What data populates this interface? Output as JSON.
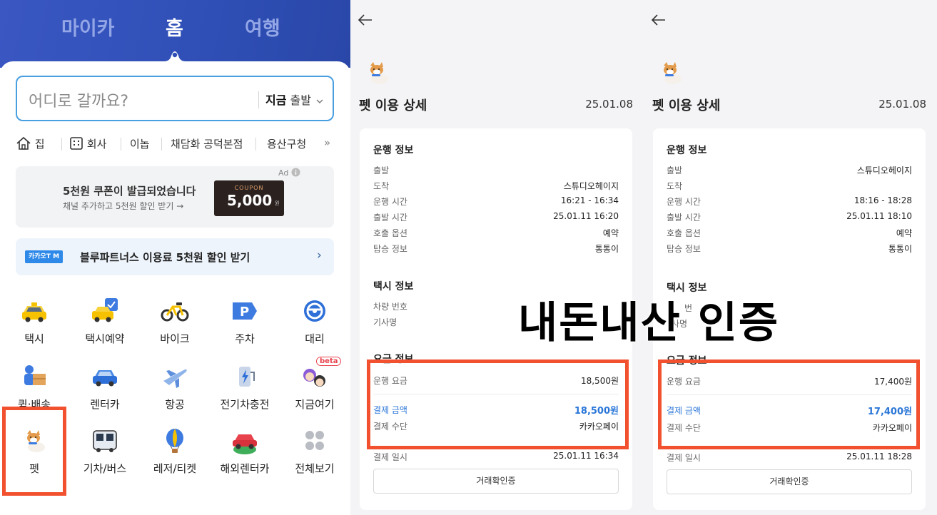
{
  "home": {
    "tabs": [
      "마이카",
      "홈",
      "여행"
    ],
    "active_tab": "홈",
    "search": {
      "placeholder": "어디로 갈까요?",
      "time_bold": "지금",
      "time_rest": "출발",
      "chevron": "chevron-down-icon"
    },
    "places": [
      {
        "label": "집",
        "icon": "home-icon"
      },
      {
        "label": "회사",
        "icon": "building-icon"
      },
      {
        "label": "이놉"
      },
      {
        "label": "채담화 공덕본점"
      },
      {
        "label": "용산구청"
      }
    ],
    "places_more": "»",
    "coupon_banner": {
      "title": "5천원 쿠폰이 발급되었습니다",
      "subtitle": "채널 추가하고 5천원 할인 받기 →",
      "ticket_label": "COUPON",
      "ticket_amount": "5,000",
      "ticket_unit": "원",
      "ad_mark": "Ad"
    },
    "bluepartners_banner": {
      "badge": "카카오T M",
      "text": "블루파트너스 이용료 5천원 할인 받기",
      "chevron": "›"
    },
    "services": [
      {
        "label": "택시",
        "icon": "taxi-icon"
      },
      {
        "label": "택시예약",
        "icon": "taxi-reserve-icon"
      },
      {
        "label": "바이크",
        "icon": "bike-icon"
      },
      {
        "label": "주차",
        "icon": "parking-icon"
      },
      {
        "label": "대리",
        "icon": "steering-wheel-icon"
      },
      {
        "label": "퀵·배송",
        "icon": "delivery-icon"
      },
      {
        "label": "렌터카",
        "icon": "rental-car-icon"
      },
      {
        "label": "항공",
        "icon": "airplane-icon"
      },
      {
        "label": "전기차충전",
        "icon": "ev-charge-icon"
      },
      {
        "label": "지금여기",
        "icon": "people-icon",
        "badge": "beta"
      },
      {
        "label": "펫",
        "icon": "pet-dog-icon"
      },
      {
        "label": "기차/버스",
        "icon": "bus-icon"
      },
      {
        "label": "레저/티켓",
        "icon": "balloon-icon"
      },
      {
        "label": "해외렌터카",
        "icon": "globe-car-icon"
      },
      {
        "label": "전체보기",
        "icon": "grid-icon"
      }
    ]
  },
  "detail1": {
    "title": "펫 이용 상세",
    "date": "25.01.08",
    "sections": {
      "ride_info": "운행 정보",
      "taxi_info": "택시 정보",
      "fare_info": "요금 정보"
    },
    "ride_rows": [
      {
        "label": "출발",
        "value": ""
      },
      {
        "label": "도착",
        "value": "스튜디오헤이지"
      },
      {
        "label": "운행 시간",
        "value": "16:21 - 16:34"
      },
      {
        "label": "출발 시간",
        "value": "25.01.11 16:20"
      },
      {
        "label": "호출 옵션",
        "value": "예약"
      },
      {
        "label": "탑승 정보",
        "value": "통통이"
      }
    ],
    "taxi_rows": [
      {
        "label": "차량 번호",
        "value": ""
      },
      {
        "label": "기사명",
        "value": ""
      }
    ],
    "fare": {
      "label": "운행 요금",
      "value": "18,500원"
    },
    "pay_amount": {
      "label": "결제 금액",
      "value": "18,500원"
    },
    "pay_method": {
      "label": "결제 수단",
      "value": "카카오페이"
    },
    "pay_time": {
      "label": "결제 일시",
      "value": "25.01.11 16:34"
    },
    "receipt_button": "거래확인증"
  },
  "detail2": {
    "title": "펫 이용 상세",
    "date": "25.01.08",
    "sections": {
      "ride_info": "운행 정보",
      "taxi_info": "택시 정보",
      "fare_info": "요금 정보"
    },
    "ride_rows": [
      {
        "label": "출발",
        "value": "스튜디오헤이지"
      },
      {
        "label": "도착",
        "value": ""
      },
      {
        "label": "운행 시간",
        "value": "18:16 - 18:28"
      },
      {
        "label": "출발 시간",
        "value": "25.01.11 18:10"
      },
      {
        "label": "호출 옵션",
        "value": "예약"
      },
      {
        "label": "탑승 정보",
        "value": "통통이"
      }
    ],
    "taxi_rows": [
      {
        "label": "번",
        "value": ""
      },
      {
        "label": "사명",
        "value": ""
      }
    ],
    "fare": {
      "label": "운행 요금",
      "value": "17,400원"
    },
    "pay_amount": {
      "label": "결제 금액",
      "value": "17,400원"
    },
    "pay_method": {
      "label": "결제 수단",
      "value": "카카오페이"
    },
    "pay_time": {
      "label": "결제 일시",
      "value": "25.01.11 18:28"
    },
    "receipt_button": "거래확인증"
  },
  "overlay_caption": "내돈내산 인증",
  "colors": {
    "brand_blue": "#2f4fb6",
    "highlight": "#f2512f",
    "link_blue": "#2a76d8",
    "search_border": "#4a9fe0"
  }
}
